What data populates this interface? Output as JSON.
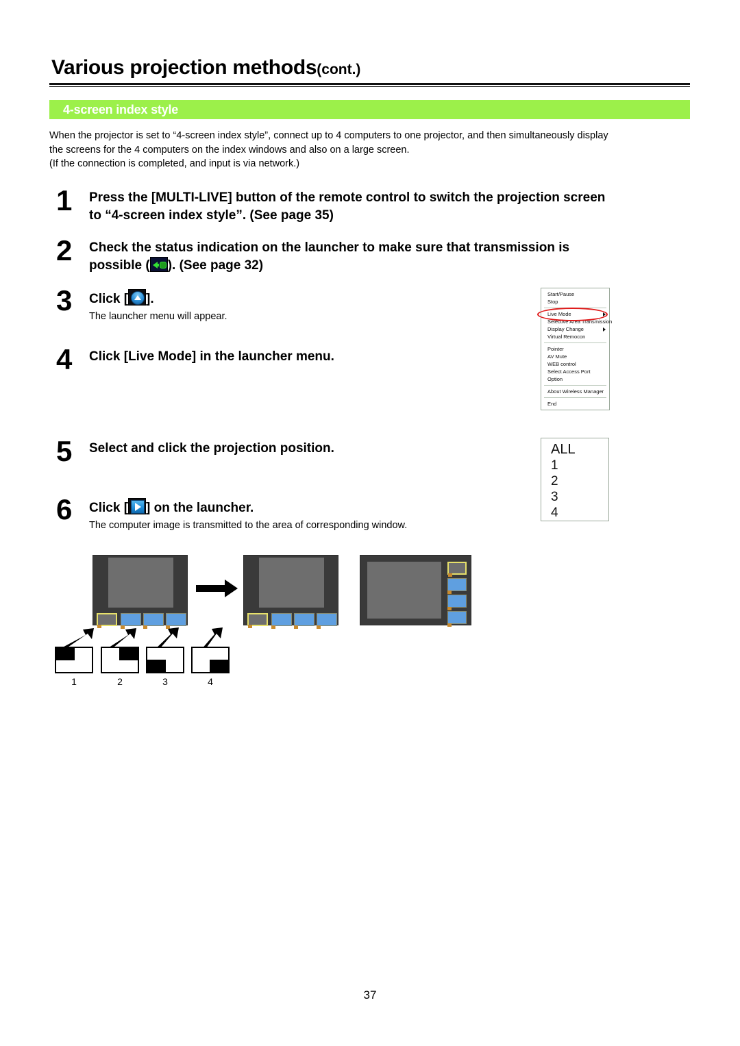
{
  "header": {
    "title": "Various projection methods",
    "title_suffix": "(cont.)"
  },
  "section": {
    "bar_label": "4-screen index style",
    "intro_line1": "When the projector is set to “4-screen index style”, connect up to 4 computers to one projector, and then simultaneously display",
    "intro_line2": "the screens for the 4 computers on the index windows and also on a large screen.",
    "intro_line3": "(If the connection is completed, and input is via network.)"
  },
  "steps": [
    {
      "number": "1",
      "head_line1": "Press the [MULTI-LIVE] button of the remote control to switch the projection screen",
      "head_line2": "to “4-screen index style”. (See page 35)",
      "sub": ""
    },
    {
      "number": "2",
      "head_line1": "Check the status indication on the launcher to make sure that transmission is",
      "head_prefix2": "possible (",
      "head_suffix2": "). (See page 32)",
      "icon": "status-transmission-icon",
      "sub": ""
    },
    {
      "number": "3",
      "head_prefix": "Click [",
      "head_suffix": "].",
      "icon": "launcher-open-icon",
      "sub": "The launcher menu will appear."
    },
    {
      "number": "4",
      "head_line1": "Click [Live Mode] in the launcher menu.",
      "sub": ""
    },
    {
      "number": "5",
      "head_line1": "Select and click the projection position.",
      "sub": ""
    },
    {
      "number": "6",
      "head_prefix": "Click [",
      "head_suffix": "] on the launcher.",
      "icon": "play-transmit-icon",
      "sub": "The computer image is transmitted to the area of corresponding window."
    }
  ],
  "launcher_menu": {
    "groups": [
      [
        "Start/Pause",
        "Stop"
      ],
      [
        "Live Mode",
        "Selective Area Transmission",
        "Display Change",
        "Virtual Remocon"
      ],
      [
        "Pointer",
        "AV Mute",
        "WEB control",
        "Select Access Port",
        "Option"
      ],
      [
        "About Wireless Manager"
      ],
      [
        "End"
      ]
    ],
    "submenu_items": [
      "Live Mode",
      "Display Change"
    ],
    "highlighted_item": "Live Mode",
    "highlight_color": "#e01b1b"
  },
  "index_box": {
    "rows": [
      "ALL",
      "1",
      "2",
      "3",
      "4"
    ]
  },
  "position_indicators": {
    "labels": [
      "1",
      "2",
      "3",
      "4"
    ],
    "quadrants": [
      "top-left",
      "top-right",
      "bottom-left",
      "bottom-right"
    ]
  },
  "colors": {
    "section_bar": "#9cf04a",
    "screen_bezel": "#3a3a3a",
    "screen_canvas": "#6e6e6e",
    "thumb_fill": "#5f9fe0",
    "thumb_selected_border": "#e6e06a"
  },
  "footer": {
    "page_number": "37"
  }
}
